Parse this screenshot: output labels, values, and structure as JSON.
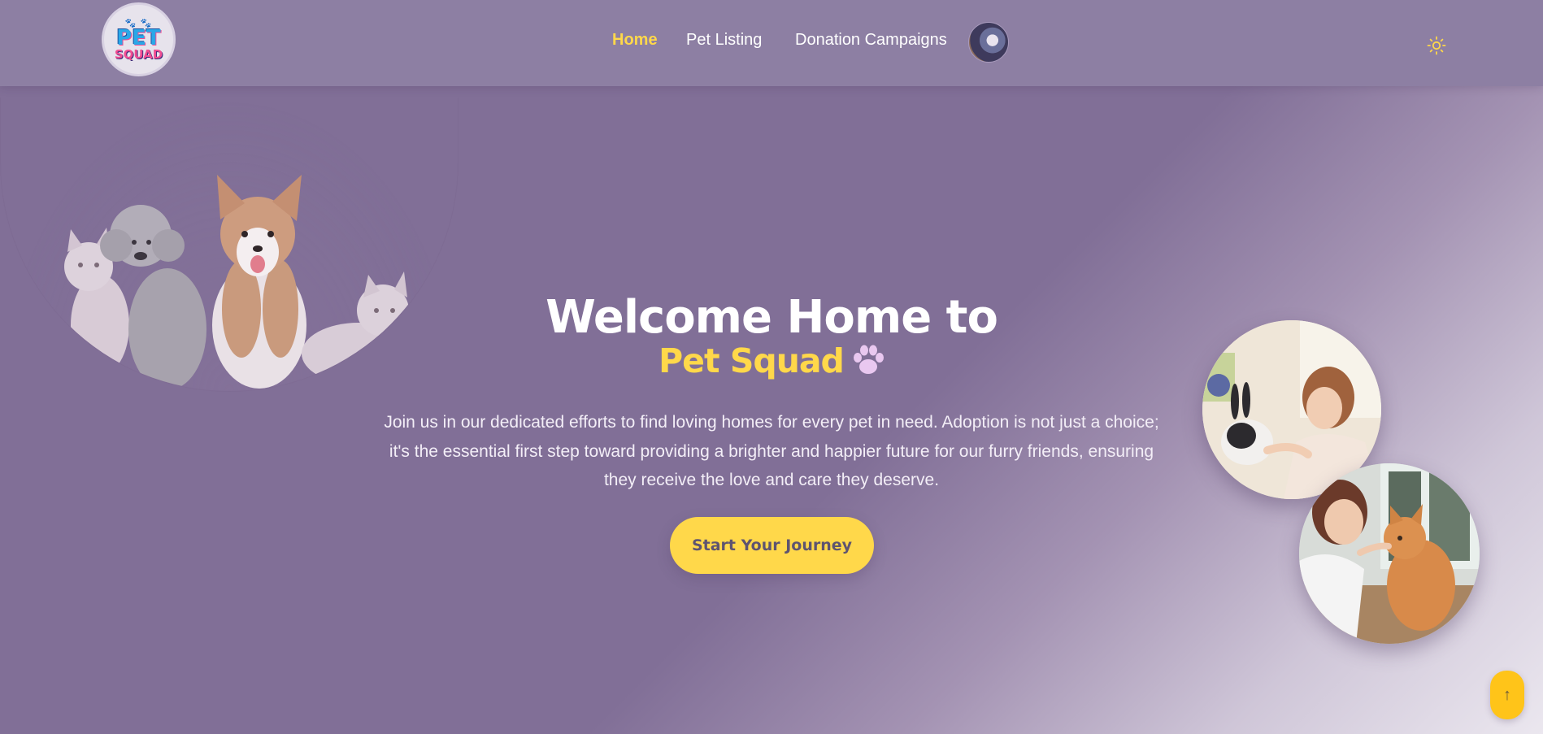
{
  "nav": {
    "logo": {
      "line1": "PET",
      "line2": "SQUAD",
      "paws": "🐾 🐾"
    },
    "links": [
      {
        "label": "Home",
        "active": true
      },
      {
        "label": "Pet Listing",
        "active": false
      },
      {
        "label": "Donation Campaigns",
        "active": false
      }
    ],
    "theme_icon": "sun-icon"
  },
  "hero": {
    "title": "Welcome Home to",
    "subtitle": "Pet Squad",
    "subtitle_icon": "paw-icon",
    "description": "Join us in our dedicated efforts to find loving homes for every pet in need. Adoption is not just a choice; it's the essential first step toward providing a brighter and happier future for our furry friends, ensuring they receive the love and care they deserve.",
    "cta_label": "Start Your Journey"
  },
  "scroll_top": {
    "label": "↑",
    "icon": "arrow-up-icon"
  },
  "colors": {
    "accent": "#ffd84a",
    "nav_bg": "#8d7fa3",
    "page_bg": "#816f97",
    "scroll_button": "#ffc419"
  }
}
